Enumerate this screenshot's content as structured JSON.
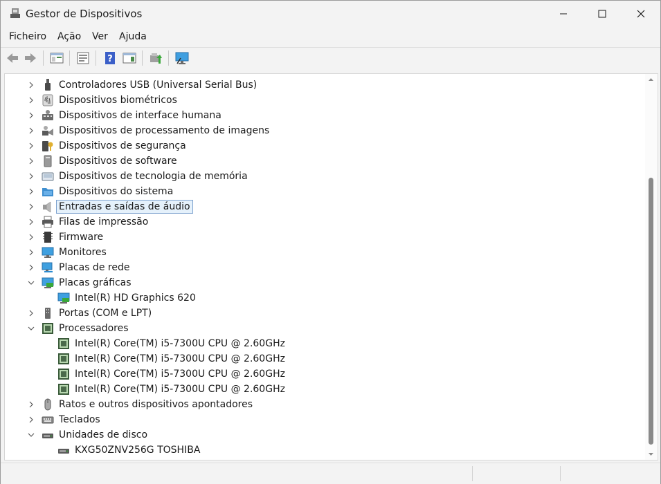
{
  "window": {
    "title": "Gestor de Dispositivos",
    "controls": [
      "minimize-icon",
      "maximize-icon",
      "close-icon"
    ]
  },
  "menu": [
    "Ficheiro",
    "Ação",
    "Ver",
    "Ajuda"
  ],
  "toolbar": [
    "back-arrow-icon",
    "forward-arrow-icon",
    "show-hide-console-tree-icon",
    "properties-icon",
    "help-icon",
    "action-pane-icon",
    "update-driver-icon",
    "scan-hardware-icon"
  ],
  "tree": [
    {
      "label": "Controladores USB (Universal Serial Bus)",
      "icon": "usb-icon",
      "expander": "collapsed",
      "level": 0
    },
    {
      "label": "Dispositivos biométricos",
      "icon": "fingerprint-icon",
      "expander": "collapsed",
      "level": 0
    },
    {
      "label": "Dispositivos de interface humana",
      "icon": "hid-icon",
      "expander": "collapsed",
      "level": 0
    },
    {
      "label": "Dispositivos de processamento de imagens",
      "icon": "camera-icon",
      "expander": "collapsed",
      "level": 0
    },
    {
      "label": "Dispositivos de segurança",
      "icon": "security-key-icon",
      "expander": "collapsed",
      "level": 0
    },
    {
      "label": "Dispositivos de software",
      "icon": "software-device-icon",
      "expander": "collapsed",
      "level": 0
    },
    {
      "label": "Dispositivos de tecnologia de memória",
      "icon": "memory-icon",
      "expander": "collapsed",
      "level": 0
    },
    {
      "label": "Dispositivos do sistema",
      "icon": "system-folder-icon",
      "expander": "collapsed",
      "level": 0
    },
    {
      "label": "Entradas e saídas de áudio",
      "icon": "speaker-icon",
      "expander": "collapsed",
      "level": 0,
      "selected": true
    },
    {
      "label": "Filas de impressão",
      "icon": "printer-icon",
      "expander": "collapsed",
      "level": 0
    },
    {
      "label": "Firmware",
      "icon": "firmware-chip-icon",
      "expander": "collapsed",
      "level": 0
    },
    {
      "label": "Monitores",
      "icon": "monitor-icon",
      "expander": "collapsed",
      "level": 0
    },
    {
      "label": "Placas de rede",
      "icon": "network-icon",
      "expander": "collapsed",
      "level": 0
    },
    {
      "label": "Placas gráficas",
      "icon": "display-adapter-icon",
      "expander": "expanded",
      "level": 0
    },
    {
      "label": "Intel(R) HD Graphics 620",
      "icon": "display-adapter-icon",
      "expander": "none",
      "level": 1
    },
    {
      "label": "Portas (COM e LPT)",
      "icon": "port-icon",
      "expander": "collapsed",
      "level": 0
    },
    {
      "label": "Processadores",
      "icon": "processor-icon",
      "expander": "expanded",
      "level": 0
    },
    {
      "label": "Intel(R) Core(TM) i5-7300U CPU @ 2.60GHz",
      "icon": "processor-icon",
      "expander": "none",
      "level": 1
    },
    {
      "label": "Intel(R) Core(TM) i5-7300U CPU @ 2.60GHz",
      "icon": "processor-icon",
      "expander": "none",
      "level": 1
    },
    {
      "label": "Intel(R) Core(TM) i5-7300U CPU @ 2.60GHz",
      "icon": "processor-icon",
      "expander": "none",
      "level": 1
    },
    {
      "label": "Intel(R) Core(TM) i5-7300U CPU @ 2.60GHz",
      "icon": "processor-icon",
      "expander": "none",
      "level": 1
    },
    {
      "label": "Ratos e outros dispositivos apontadores",
      "icon": "mouse-icon",
      "expander": "collapsed",
      "level": 0
    },
    {
      "label": "Teclados",
      "icon": "keyboard-icon",
      "expander": "collapsed",
      "level": 0
    },
    {
      "label": "Unidades de disco",
      "icon": "disk-drive-icon",
      "expander": "expanded",
      "level": 0
    },
    {
      "label": "KXG50ZNV256G TOSHIBA",
      "icon": "disk-drive-icon",
      "expander": "none",
      "level": 1
    }
  ]
}
